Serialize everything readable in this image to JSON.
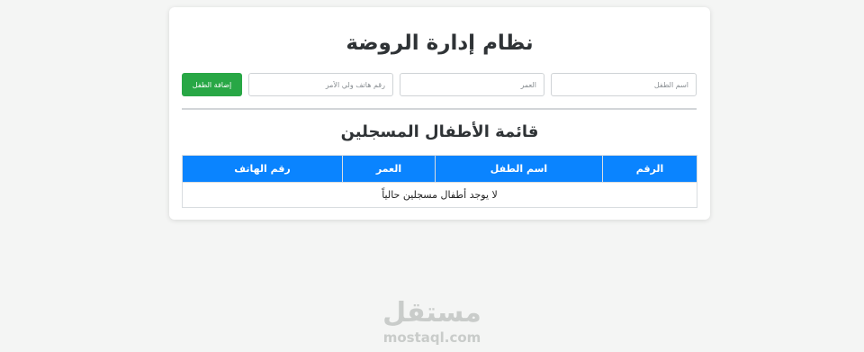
{
  "page": {
    "title": "نظام إدارة الروضة"
  },
  "form": {
    "child_name_placeholder": "اسم الطفل",
    "age_placeholder": "العمر",
    "parent_phone_placeholder": "رقم هاتف ولي الأمر",
    "add_button_label": "إضافة الطفل",
    "add_button_color": "#28a745"
  },
  "list": {
    "title": "قائمة الأطفال المسجلين",
    "columns": [
      "الرقم",
      "اسم الطفل",
      "العمر",
      "رقم الهاتف"
    ],
    "header_color": "#0a84ff",
    "empty_message": "لا يوجد أطفال مسجلين حالياً",
    "rows": []
  },
  "watermark": {
    "logo_text": "مستقل",
    "url": "mostaql.com"
  }
}
